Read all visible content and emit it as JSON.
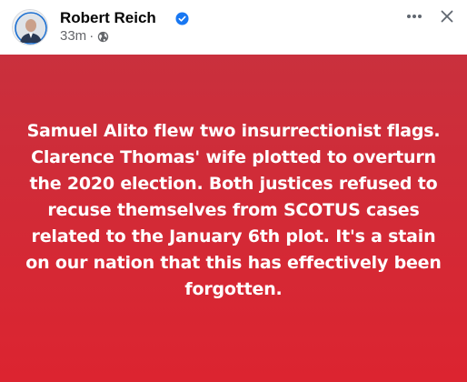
{
  "post": {
    "author": "Robert Reich",
    "timestamp": "33m",
    "separator": "·",
    "audience_icon": "globe-icon",
    "verified_icon": "verified-badge-icon",
    "more_icon": "more-horizontal-icon",
    "close_icon": "close-icon",
    "body_text": "Samuel Alito flew two insurrectionist flags. Clarence Thomas' wife plotted to overturn the 2020 election. Both justices refused to recuse themselves from SCOTUS cases related to the January 6th plot. It's a stain on our nation that this has effectively been forgotten."
  },
  "colors": {
    "card_background": "#d82a36",
    "card_text": "#ffffff",
    "verified_badge": "#1877f2",
    "name_text": "#050505",
    "meta_text": "#65676b"
  }
}
